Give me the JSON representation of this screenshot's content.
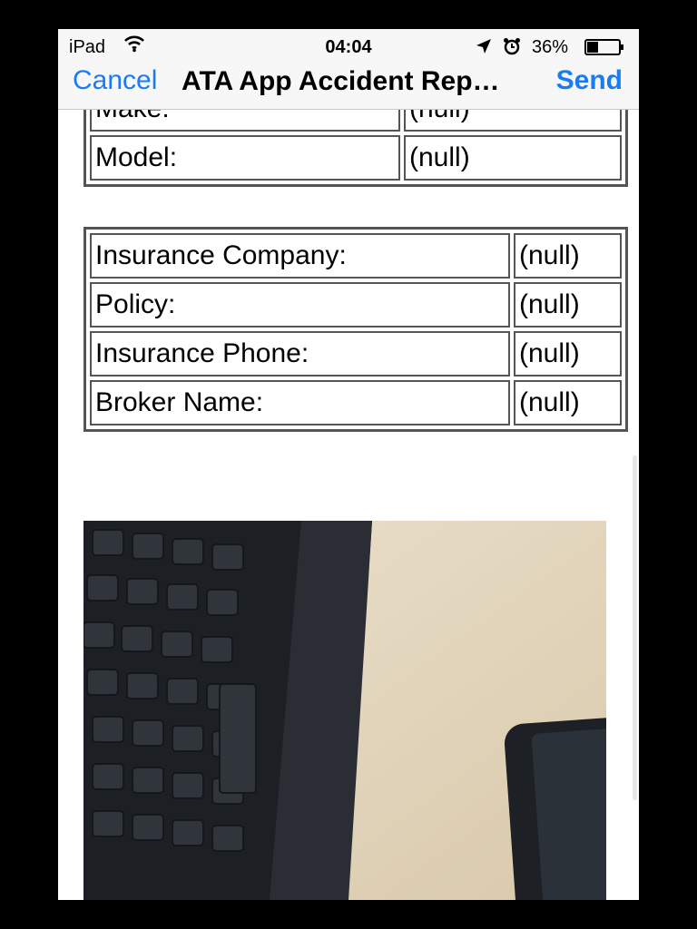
{
  "status": {
    "carrier": "iPad",
    "time": "04:04",
    "battery": "36%",
    "battery_level": 0.36
  },
  "nav": {
    "cancel": "Cancel",
    "title": "ATA App Accident Rep…",
    "send": "Send"
  },
  "vehicle": {
    "rows": [
      {
        "label": "Make:",
        "value": "(null)"
      },
      {
        "label": "Model:",
        "value": "(null)"
      }
    ]
  },
  "insurance": {
    "rows": [
      {
        "label": "Insurance Company:",
        "value": "(null)"
      },
      {
        "label": "Policy:",
        "value": "(null)"
      },
      {
        "label": "Insurance Phone:",
        "value": "(null)"
      },
      {
        "label": "Broker Name:",
        "value": "(null)"
      }
    ]
  },
  "attachment": {
    "icon": "photo-icon"
  },
  "colors": {
    "accent": "#1a7cf3",
    "border": "#555555",
    "bar": "#f7f7f7"
  }
}
